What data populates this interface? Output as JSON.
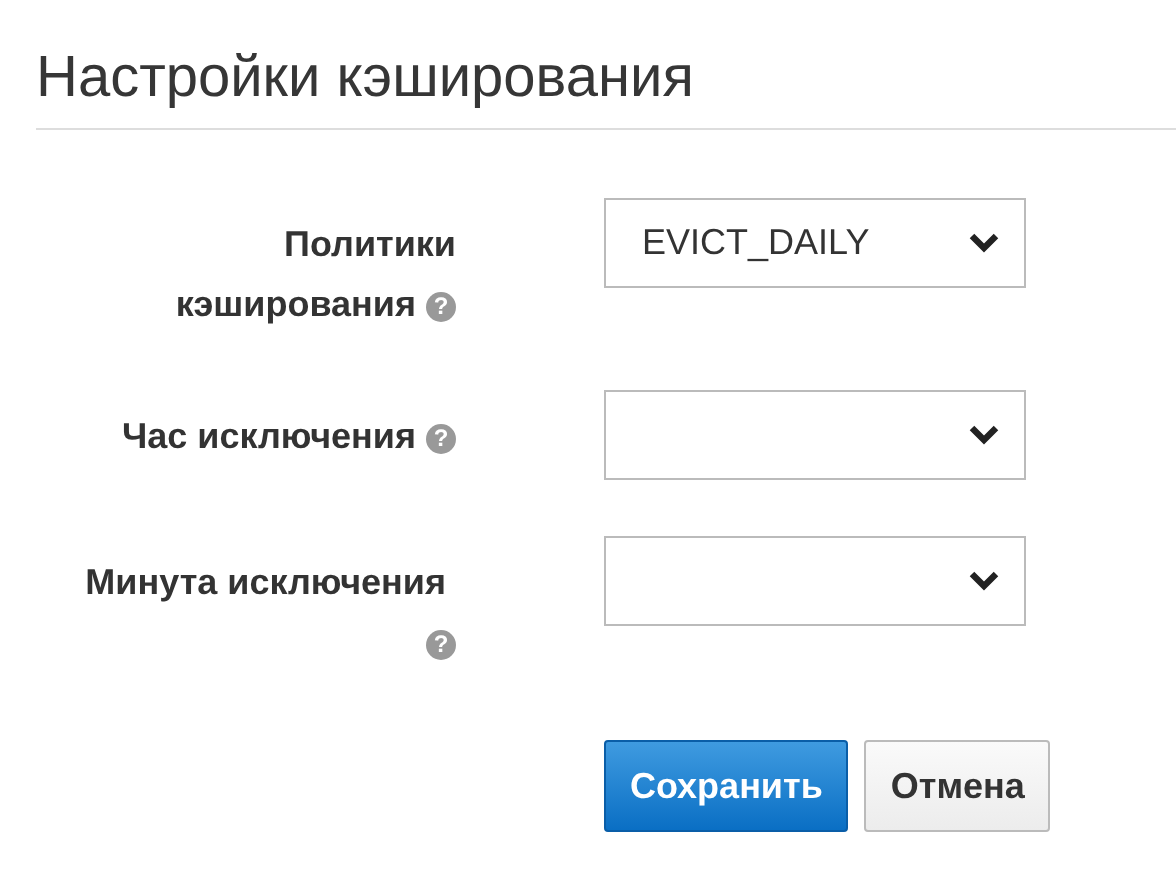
{
  "title": "Настройки кэширования",
  "fields": [
    {
      "label": "Политики кэширования",
      "value": "EVICT_DAILY",
      "help": "?"
    },
    {
      "label": "Час исключения",
      "help": "?"
    },
    {
      "label": "Минута исключения",
      "help": "?"
    }
  ],
  "buttons": [
    {
      "label": "Сохранить",
      "kind": "primary"
    },
    {
      "label": "Отмена",
      "kind": "default"
    }
  ]
}
